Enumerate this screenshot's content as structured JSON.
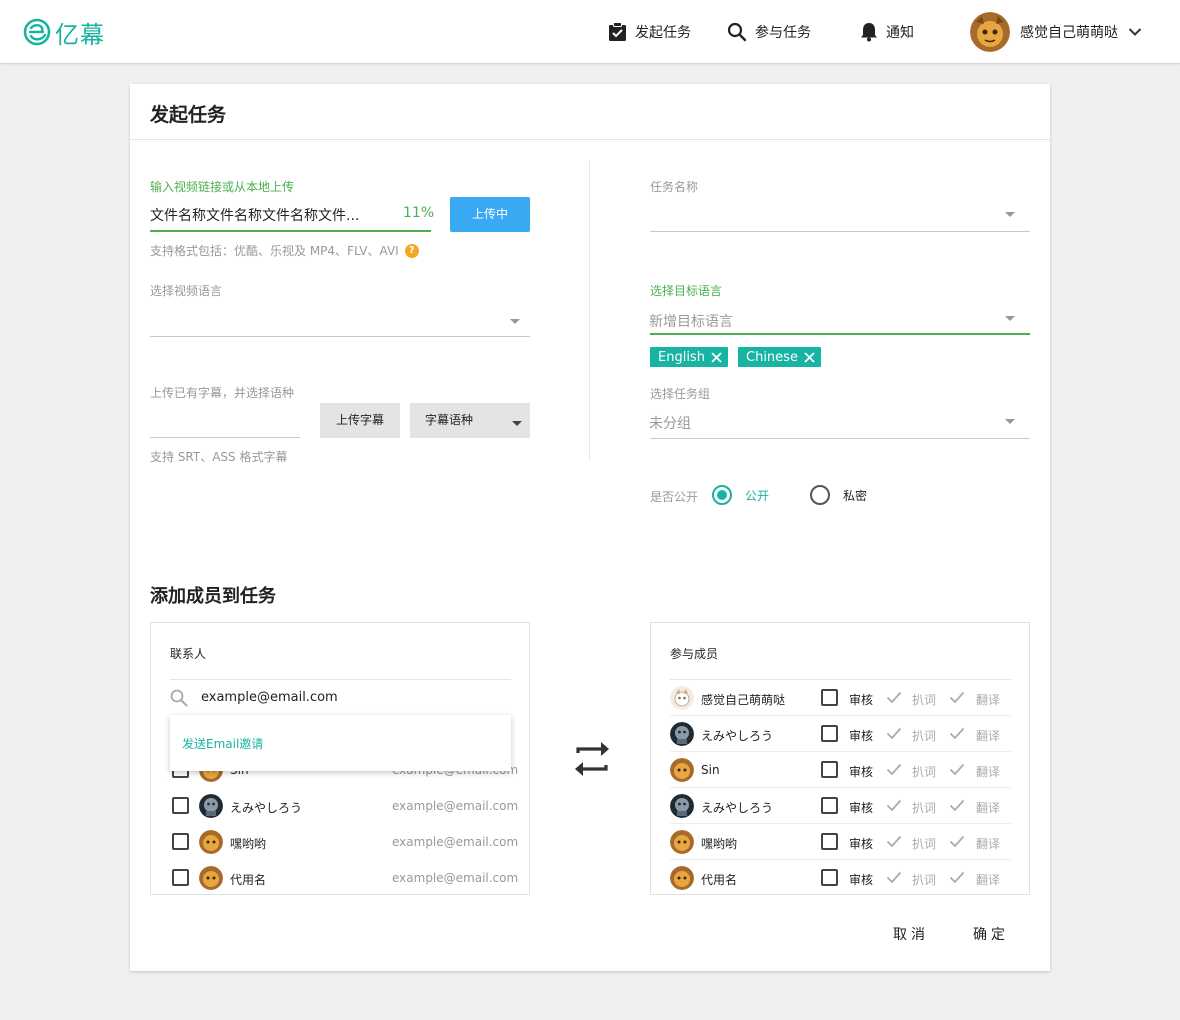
{
  "header": {
    "logo_text": "亿幕",
    "nav": [
      {
        "label": "发起任务",
        "icon": "clipboard-check-icon"
      },
      {
        "label": "参与任务",
        "icon": "search-icon"
      },
      {
        "label": "通知",
        "icon": "bell-icon"
      }
    ],
    "user_name": "感觉自己萌萌哒"
  },
  "page": {
    "title": "发起任务",
    "video": {
      "label": "输入视频链接或从本地上传",
      "file_name": "文件名称文件名称文件名称文件...",
      "progress_text": "11%",
      "progress": 0.11,
      "upload_button": "上传中",
      "hint": "支持格式包括：优酷、乐视及 MP4、FLV、AVI",
      "hint_icon": "?"
    },
    "video_language": {
      "label": "选择视频语言",
      "value": ""
    },
    "subtitle": {
      "label": "上传已有字幕，并选择语种",
      "upload_button": "上传字幕",
      "language_select": "字幕语种",
      "hint": "支持 SRT、ASS 格式字幕"
    },
    "task_name": {
      "label": "任务名称",
      "value": ""
    },
    "target_language": {
      "label": "选择目标语言",
      "placeholder": "新增目标语言",
      "chips": [
        "English",
        "Chinese"
      ]
    },
    "task_group": {
      "label": "选择任务组",
      "value": "未分组"
    },
    "visibility": {
      "label": "是否公开",
      "options": [
        "公开",
        "私密"
      ],
      "selected": "公开"
    },
    "members_section_title": "添加成员到任务",
    "contacts": {
      "title": "联系人",
      "search_value": "example@email.com",
      "dropdown_item": "发送Email邀请",
      "rows": [
        {
          "name": "Sin",
          "email": "example@email.com"
        },
        {
          "name": "えみやしろう",
          "email": "example@email.com"
        },
        {
          "name": "嘿哟哟",
          "email": "example@email.com"
        },
        {
          "name": "代用名",
          "email": "example@email.com"
        }
      ]
    },
    "participants": {
      "title": "参与成员",
      "roles": [
        "审核",
        "扒词",
        "翻译"
      ],
      "rows": [
        {
          "name": "感觉自己萌萌哒"
        },
        {
          "name": "えみやしろう"
        },
        {
          "name": "Sin"
        },
        {
          "name": "えみやしろう"
        },
        {
          "name": "嘿哟哟"
        },
        {
          "name": "代用名"
        }
      ]
    },
    "cancel_button": "取消",
    "confirm_button": "确定"
  },
  "colors": {
    "teal": "#17b3a3",
    "green": "#4caf50",
    "blue": "#39a9f4"
  }
}
